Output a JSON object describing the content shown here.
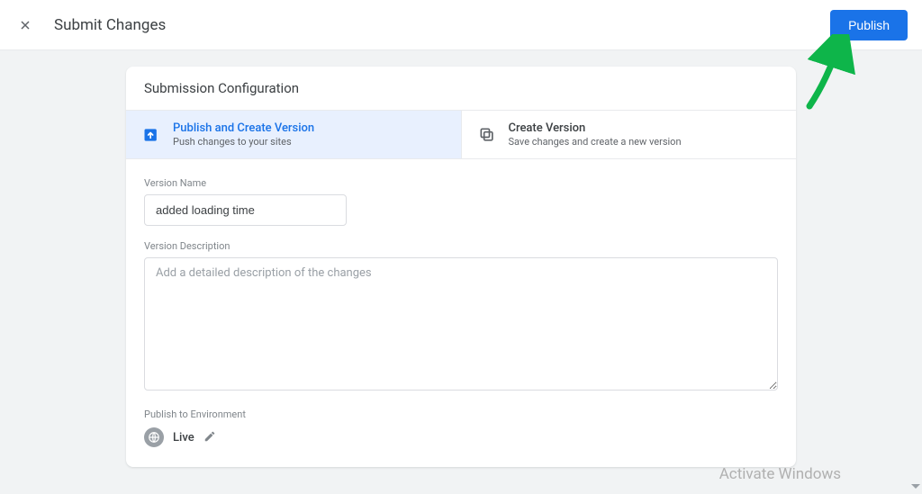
{
  "topbar": {
    "title": "Submit Changes",
    "publish_label": "Publish"
  },
  "card": {
    "header": "Submission Configuration",
    "tabs": {
      "publish": {
        "title": "Publish and Create Version",
        "subtitle": "Push changes to your sites"
      },
      "create": {
        "title": "Create Version",
        "subtitle": "Save changes and create a new version"
      }
    },
    "version_name_label": "Version Name",
    "version_name_value": "added loading time",
    "version_desc_label": "Version Description",
    "version_desc_placeholder": "Add a detailed description of the changes",
    "publish_env_label": "Publish to Environment",
    "env_name": "Live"
  },
  "colors": {
    "primary": "#1a73e8",
    "accent_arrow": "#0eb54a"
  },
  "watermark": "Activate Windows"
}
